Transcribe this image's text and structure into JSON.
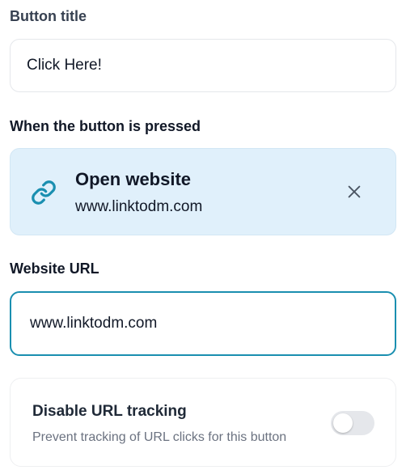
{
  "button_title": {
    "label": "Button title",
    "value": "Click Here!"
  },
  "press_action": {
    "label": "When the button is pressed",
    "title": "Open website",
    "subtitle": "www.linktodm.com",
    "icon": "link-icon",
    "accent": "#1a8fb0"
  },
  "website_url": {
    "label": "Website URL",
    "value": "www.linktodm.com"
  },
  "url_tracking": {
    "title": "Disable URL tracking",
    "description": "Prevent tracking of URL clicks for this button",
    "enabled": false
  }
}
